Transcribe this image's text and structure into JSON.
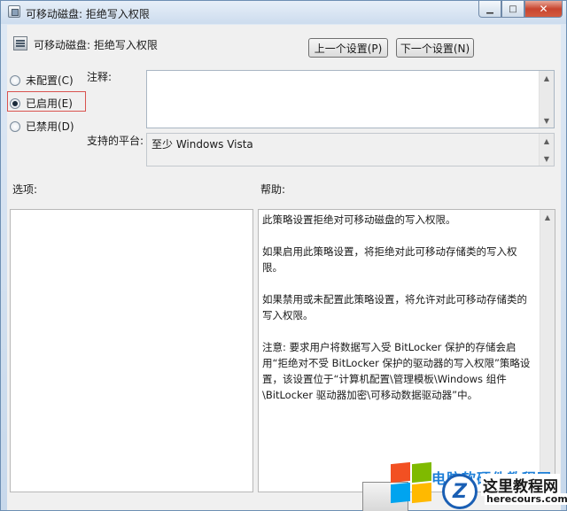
{
  "window": {
    "title": "可移动磁盘: 拒绝写入权限"
  },
  "header": {
    "policy_title": "可移动磁盘: 拒绝写入权限",
    "prev_button": "上一个设置(P)",
    "next_button": "下一个设置(N)"
  },
  "state": {
    "options": [
      {
        "label": "未配置(C)",
        "checked": false
      },
      {
        "label": "已启用(E)",
        "checked": true
      },
      {
        "label": "已禁用(D)",
        "checked": false
      }
    ]
  },
  "comment": {
    "label": "注释:",
    "value": ""
  },
  "platform": {
    "label": "支持的平台:",
    "value": "至少 Windows Vista"
  },
  "options_panel": {
    "label": "选项:"
  },
  "help_panel": {
    "label": "帮助:",
    "paragraphs": [
      "此策略设置拒绝对可移动磁盘的写入权限。",
      "如果启用此策略设置，将拒绝对此可移动存储类的写入权限。",
      "如果禁用或未配置此策略设置，将允许对此可移动存储类的写入权限。",
      "注意: 要求用户将数据写入受 BitLocker 保护的存储会启用“拒绝对不受 BitLocker 保护的驱动器的写入权限”策略设置，该设置位于“计算机配置\\管理模板\\Windows 组件\\BitLocker 驱动器加密\\可移动数据驱动器”中。"
    ]
  },
  "watermark": {
    "headline": "电脑软硬件教程网",
    "site_name": "这里教程网",
    "site_url": "herecours.com",
    "logo_letter": "Z"
  },
  "colors": {
    "highlight_border": "#d9534f",
    "title_gradient_top": "#e7eff8",
    "close_button": "#c8452f"
  }
}
